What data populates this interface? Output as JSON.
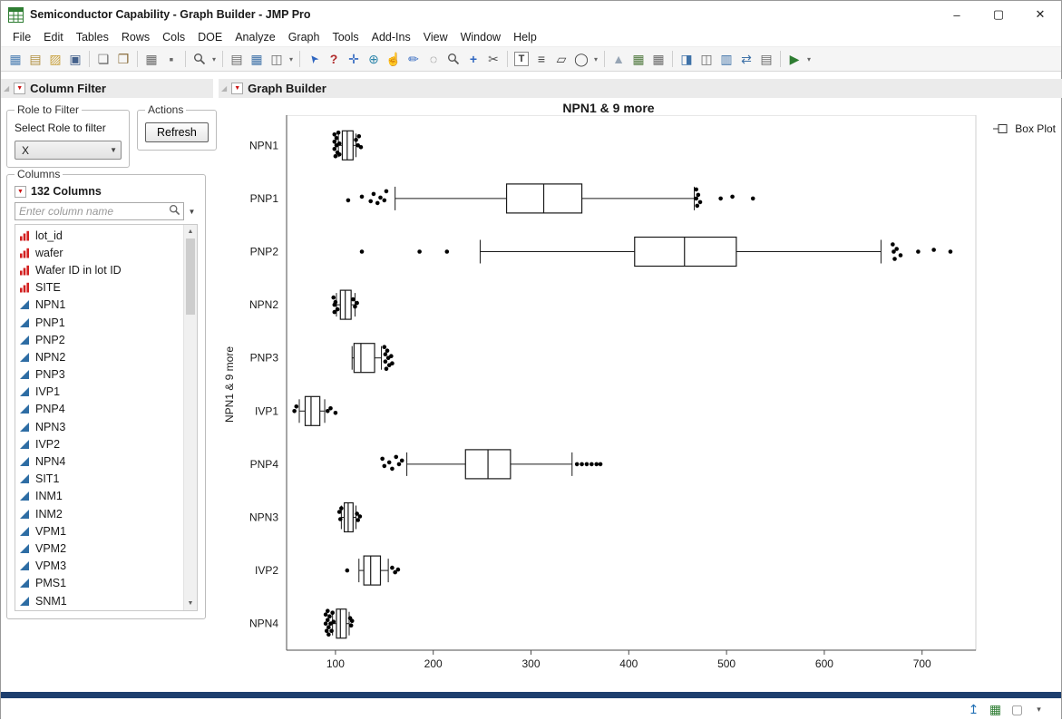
{
  "window": {
    "title": "Semiconductor Capability - Graph Builder - JMP Pro",
    "controls": {
      "minimize": "–",
      "maximize": "▢",
      "close": "✕"
    }
  },
  "menu": {
    "items": [
      "File",
      "Edit",
      "Tables",
      "Rows",
      "Cols",
      "DOE",
      "Analyze",
      "Graph",
      "Tools",
      "Add-Ins",
      "View",
      "Window",
      "Help"
    ]
  },
  "toolbar": {
    "items": [
      {
        "name": "new-data-table-icon",
        "glyph": "▦",
        "color": "#4d7fb3"
      },
      {
        "name": "new-journal-icon",
        "glyph": "▤",
        "color": "#b08f3f"
      },
      {
        "name": "open-icon",
        "glyph": "▨",
        "color": "#c9a23f"
      },
      {
        "name": "save-icon",
        "glyph": "▣",
        "color": "#44618c"
      },
      {
        "type": "sep"
      },
      {
        "name": "copy-icon",
        "glyph": "❏",
        "color": "#6b6b6b"
      },
      {
        "name": "paste-icon",
        "glyph": "❐",
        "color": "#8a6d3b"
      },
      {
        "type": "sep"
      },
      {
        "name": "data-grid-icon",
        "glyph": "▦",
        "color": "#6b6b6b"
      },
      {
        "name": "lock-icon",
        "glyph": "▪",
        "color": "#6b6b6b"
      },
      {
        "type": "sep"
      },
      {
        "name": "search-icon",
        "svg": "magnifier"
      },
      {
        "type": "caret"
      },
      {
        "type": "sep"
      },
      {
        "name": "journal-icon",
        "glyph": "▤",
        "color": "#6b6b6b"
      },
      {
        "name": "annotate-window-icon",
        "glyph": "▦",
        "color": "#3f72a8"
      },
      {
        "name": "window-tools-icon",
        "glyph": "◫",
        "color": "#6b6b6b"
      },
      {
        "type": "caret"
      },
      {
        "type": "sep"
      },
      {
        "name": "arrow-tool-icon",
        "glyph": "➤",
        "color": "#2f66c0",
        "cls": "rot-nw"
      },
      {
        "name": "help-tool-icon",
        "glyph": "?",
        "color": "#b02a2a",
        "cls": "bold"
      },
      {
        "name": "move-tool-icon",
        "glyph": "✛",
        "color": "#2f66c0"
      },
      {
        "name": "globe-tool-icon",
        "glyph": "⊕",
        "color": "#2e86ab"
      },
      {
        "name": "hand-tool-icon",
        "glyph": "☝",
        "color": "#a07840"
      },
      {
        "name": "brush-tool-icon",
        "glyph": "✏",
        "color": "#2f66c0"
      },
      {
        "name": "lasso-tool-icon",
        "glyph": "◌",
        "color": "#555555"
      },
      {
        "name": "magnifier-tool-icon",
        "svg": "magnifier"
      },
      {
        "name": "crosshair-tool-icon",
        "glyph": "+",
        "color": "#2f66c0",
        "cls": "bold"
      },
      {
        "name": "scissors-tool-icon",
        "glyph": "✂",
        "color": "#555555"
      },
      {
        "type": "sep"
      },
      {
        "name": "text-annotate-icon",
        "glyph": "T",
        "cls": "boxed"
      },
      {
        "name": "line-annotate-icon",
        "glyph": "≡",
        "color": "#444444"
      },
      {
        "name": "polygon-annotate-icon",
        "glyph": "▱",
        "color": "#444444"
      },
      {
        "name": "oval-annotate-icon",
        "glyph": "◯",
        "color": "#444444"
      },
      {
        "type": "caret"
      },
      {
        "type": "sep"
      },
      {
        "name": "preferences-icon",
        "glyph": "▲",
        "color": "#97a5b5"
      },
      {
        "name": "summary-table-icon",
        "glyph": "▦",
        "color": "#50793f"
      },
      {
        "name": "subset-table-icon",
        "glyph": "▦",
        "color": "#6b6b6b"
      },
      {
        "type": "sep"
      },
      {
        "name": "report-window-icon",
        "glyph": "◨",
        "color": "#3f72a8"
      },
      {
        "name": "layout-window-icon",
        "glyph": "◫",
        "color": "#6b6b6b"
      },
      {
        "name": "column-viewer-icon",
        "glyph": "▥",
        "color": "#3f72a8"
      },
      {
        "name": "transpose-table-icon",
        "glyph": "⇄",
        "color": "#3f72a8"
      },
      {
        "name": "join-tables-icon",
        "glyph": "▤",
        "color": "#6b6b6b"
      },
      {
        "type": "sep"
      },
      {
        "name": "run-script-icon",
        "glyph": "▶",
        "color": "#2e7d32"
      },
      {
        "type": "caret"
      }
    ]
  },
  "left_panel": {
    "header": "Column Filter",
    "role_group": {
      "title": "Role to Filter",
      "label": "Select Role to filter",
      "value": "X"
    },
    "actions_group": {
      "title": "Actions",
      "refresh_label": "Refresh"
    },
    "columns_group": {
      "title": "Columns",
      "count_label": "132 Columns",
      "search_placeholder": "Enter column name",
      "items": [
        {
          "name": "lot_id",
          "role": "nominal"
        },
        {
          "name": "wafer",
          "role": "nominal"
        },
        {
          "name": "Wafer ID in lot ID",
          "role": "nominal"
        },
        {
          "name": "SITE",
          "role": "nominal"
        },
        {
          "name": "NPN1",
          "role": "continuous"
        },
        {
          "name": "PNP1",
          "role": "continuous"
        },
        {
          "name": "PNP2",
          "role": "continuous"
        },
        {
          "name": "NPN2",
          "role": "continuous"
        },
        {
          "name": "PNP3",
          "role": "continuous"
        },
        {
          "name": "IVP1",
          "role": "continuous"
        },
        {
          "name": "PNP4",
          "role": "continuous"
        },
        {
          "name": "NPN3",
          "role": "continuous"
        },
        {
          "name": "IVP2",
          "role": "continuous"
        },
        {
          "name": "NPN4",
          "role": "continuous"
        },
        {
          "name": "SIT1",
          "role": "continuous"
        },
        {
          "name": "INM1",
          "role": "continuous"
        },
        {
          "name": "INM2",
          "role": "continuous"
        },
        {
          "name": "VPM1",
          "role": "continuous"
        },
        {
          "name": "VPM2",
          "role": "continuous"
        },
        {
          "name": "VPM3",
          "role": "continuous"
        },
        {
          "name": "PMS1",
          "role": "continuous"
        },
        {
          "name": "SNM1",
          "role": "continuous"
        }
      ]
    }
  },
  "graph_panel": {
    "header": "Graph Builder"
  },
  "chart_data": {
    "type": "boxplot",
    "title": "NPN1 & 9 more",
    "ylabel": "NPN1 & 9 more",
    "xlabel": "",
    "xlim": [
      50,
      755
    ],
    "xticks": [
      100,
      200,
      300,
      400,
      500,
      600,
      700
    ],
    "grid": false,
    "legend_items": [
      "Box Plot"
    ],
    "legend_position": "right-top",
    "categories": [
      "NPN1",
      "PNP1",
      "PNP2",
      "NPN2",
      "PNP3",
      "IVP1",
      "PNP4",
      "NPN3",
      "IVP2",
      "NPN4"
    ],
    "series": [
      {
        "name": "NPN1",
        "low": 103,
        "q1": 107,
        "median": 112,
        "q3": 118,
        "high": 121,
        "outliers": [
          [
            99,
            -12
          ],
          [
            99,
            -4
          ],
          [
            99,
            4
          ],
          [
            100,
            12
          ],
          [
            101,
            -8
          ],
          [
            101,
            0
          ],
          [
            102,
            8
          ],
          [
            103,
            -14
          ],
          [
            104,
            -2
          ],
          [
            104,
            10
          ],
          [
            121,
            -6
          ],
          [
            123,
            0
          ],
          [
            124,
            -10
          ],
          [
            126,
            2
          ]
        ]
      },
      {
        "name": "PNP1",
        "low": 161,
        "q1": 275,
        "median": 313,
        "q3": 352,
        "high": 467,
        "outliers": [
          [
            113,
            2
          ],
          [
            127,
            -2
          ],
          [
            136,
            3
          ],
          [
            139,
            -5
          ],
          [
            143,
            5
          ],
          [
            146,
            -1
          ],
          [
            150,
            2
          ],
          [
            152,
            -8
          ],
          [
            469,
            -10
          ],
          [
            469,
            0
          ],
          [
            470,
            8
          ],
          [
            471,
            -4
          ],
          [
            473,
            4
          ],
          [
            494,
            0
          ],
          [
            506,
            -2
          ],
          [
            527,
            0
          ]
        ]
      },
      {
        "name": "PNP2",
        "low": 248,
        "q1": 406,
        "median": 457,
        "q3": 510,
        "high": 658,
        "outliers": [
          [
            127,
            0
          ],
          [
            186,
            0
          ],
          [
            214,
            0
          ],
          [
            670,
            -8
          ],
          [
            671,
            0
          ],
          [
            672,
            8
          ],
          [
            674,
            -3
          ],
          [
            678,
            4
          ],
          [
            696,
            0
          ],
          [
            712,
            -2
          ],
          [
            729,
            0
          ]
        ]
      },
      {
        "name": "NPN2",
        "low": 101,
        "q1": 105,
        "median": 110,
        "q3": 116,
        "high": 120,
        "outliers": [
          [
            98,
            -8
          ],
          [
            99,
            0
          ],
          [
            99,
            8
          ],
          [
            100,
            -3
          ],
          [
            102,
            5
          ],
          [
            118,
            -6
          ],
          [
            120,
            2
          ],
          [
            122,
            -2
          ]
        ]
      },
      {
        "name": "PNP3",
        "low": 117,
        "q1": 119,
        "median": 126,
        "q3": 140,
        "high": 147,
        "outliers": [
          [
            150,
            -12
          ],
          [
            151,
            -4
          ],
          [
            151,
            4
          ],
          [
            152,
            12
          ],
          [
            153,
            -8
          ],
          [
            154,
            0
          ],
          [
            155,
            8
          ],
          [
            157,
            -2
          ],
          [
            158,
            6
          ]
        ]
      },
      {
        "name": "IVP1",
        "low": 63,
        "q1": 69,
        "median": 75,
        "q3": 84,
        "high": 89,
        "outliers": [
          [
            58,
            0
          ],
          [
            60,
            -5
          ],
          [
            92,
            0
          ],
          [
            95,
            -3
          ],
          [
            100,
            2
          ]
        ]
      },
      {
        "name": "PNP4",
        "low": 173,
        "q1": 233,
        "median": 256,
        "q3": 279,
        "high": 342,
        "outliers": [
          [
            148,
            -6
          ],
          [
            150,
            2
          ],
          [
            155,
            -2
          ],
          [
            158,
            5
          ],
          [
            162,
            -8
          ],
          [
            165,
            0
          ],
          [
            168,
            -4
          ],
          [
            347,
            0
          ],
          [
            352,
            0
          ],
          [
            357,
            0
          ],
          [
            362,
            0
          ],
          [
            367,
            0
          ],
          [
            371,
            0
          ]
        ]
      },
      {
        "name": "NPN3",
        "low": 106,
        "q1": 109,
        "median": 113,
        "q3": 118,
        "high": 121,
        "outliers": [
          [
            104,
            -6
          ],
          [
            105,
            2
          ],
          [
            106,
            -10
          ],
          [
            122,
            -4
          ],
          [
            123,
            3
          ],
          [
            125,
            -1
          ]
        ]
      },
      {
        "name": "IVP2",
        "low": 124,
        "q1": 129,
        "median": 136,
        "q3": 146,
        "high": 154,
        "outliers": [
          [
            112,
            0
          ],
          [
            158,
            -3
          ],
          [
            161,
            2
          ],
          [
            164,
            -1
          ]
        ]
      },
      {
        "name": "NPN4",
        "low": 97,
        "q1": 101,
        "median": 105,
        "q3": 111,
        "high": 114,
        "outliers": [
          [
            90,
            -10
          ],
          [
            90,
            0
          ],
          [
            91,
            8
          ],
          [
            92,
            -14
          ],
          [
            92,
            -4
          ],
          [
            93,
            4
          ],
          [
            93,
            12
          ],
          [
            94,
            -8
          ],
          [
            95,
            0
          ],
          [
            96,
            8
          ],
          [
            97,
            -12
          ],
          [
            98,
            -2
          ],
          [
            115,
            -6
          ],
          [
            116,
            2
          ],
          [
            117,
            -3
          ]
        ]
      }
    ]
  },
  "statusbar": {
    "icons": [
      {
        "name": "go-to-top-icon",
        "glyph": "↥",
        "color": "#1f6fb5"
      },
      {
        "name": "data-table-icon",
        "glyph": "▦",
        "color": "#2e7d32"
      },
      {
        "name": "display-box-icon",
        "glyph": "▢",
        "color": "#8a8a8a"
      },
      {
        "name": "statusbar-caret-icon",
        "glyph": "▾",
        "color": "#555555"
      }
    ]
  }
}
